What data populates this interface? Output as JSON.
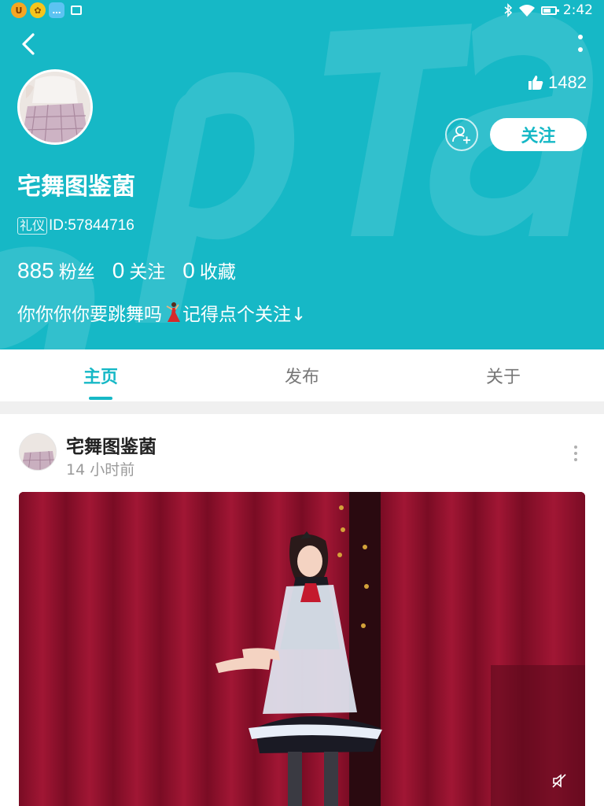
{
  "status_bar": {
    "app_icons": [
      "u-app-icon",
      "puzzle-app-icon",
      "chat-app-icon",
      "mail-icon"
    ],
    "app_badges": [
      "U",
      "✿",
      "…"
    ],
    "time": "2:42"
  },
  "profile": {
    "likes_count": "1482",
    "follow_label": "关注",
    "username": "宅舞图鉴菌",
    "badge": "礼仪",
    "id_text": "ID:57844716",
    "stats": [
      {
        "value": "885",
        "label": "粉丝"
      },
      {
        "value": "0",
        "label": "关注"
      },
      {
        "value": "0",
        "label": "收藏"
      }
    ],
    "bio_before": "你你你你要跳舞吗",
    "bio_after": "记得点个关注↓"
  },
  "tabs": [
    {
      "label": "主页",
      "active": true
    },
    {
      "label": "发布",
      "active": false
    },
    {
      "label": "关于",
      "active": false
    }
  ],
  "post": {
    "author": "宅舞图鉴菌",
    "time_ago": "14 小时前"
  },
  "colors": {
    "accent": "#16b8c6",
    "header_bg": "#16b8c6",
    "video_bg": "#8c0f2a"
  }
}
